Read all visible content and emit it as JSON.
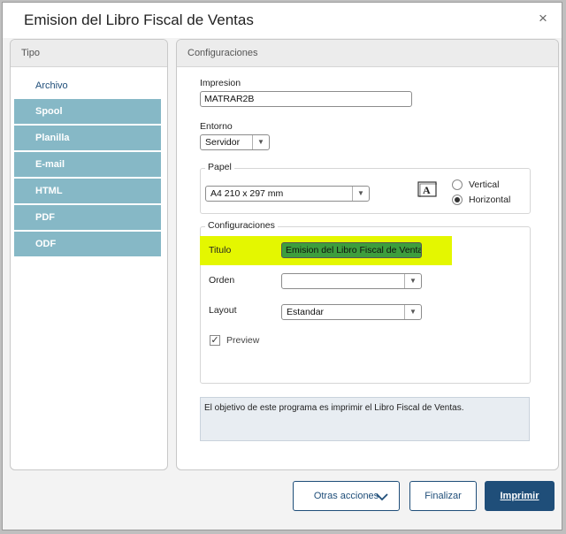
{
  "window": {
    "title": "Emision del Libro Fiscal de Ventas",
    "close_glyph": "×"
  },
  "tipo": {
    "header": "Tipo",
    "items": [
      {
        "label": "Archivo",
        "active": true
      },
      {
        "label": "Spool",
        "active": false
      },
      {
        "label": "Planilla",
        "active": false
      },
      {
        "label": "E-mail",
        "active": false
      },
      {
        "label": "HTML",
        "active": false
      },
      {
        "label": "PDF",
        "active": false
      },
      {
        "label": "ODF",
        "active": false
      }
    ]
  },
  "config": {
    "header": "Configuraciones",
    "impresion": {
      "label": "Impresion",
      "value": "MATRAR2B"
    },
    "entorno": {
      "label": "Entorno",
      "value": "Servidor"
    },
    "papel": {
      "legend": "Papel",
      "size": "A4 210 x 297 mm",
      "orientation_vertical": "Vertical",
      "orientation_horizontal": "Horizontal",
      "selected": "Horizontal"
    },
    "configuraciones": {
      "legend": "Configuraciones",
      "titulo_label": "Titulo",
      "titulo_value": "Emision del Libro Fiscal de Ventas",
      "orden_label": "Orden",
      "orden_value": "",
      "layout_label": "Layout",
      "layout_value": "Estandar",
      "preview_label": "Preview",
      "preview_checked": true
    },
    "description": "El objetivo de este programa es imprimir el Libro Fiscal de Ventas."
  },
  "footer": {
    "otras_acciones": "Otras acciones",
    "finalizar": "Finalizar",
    "imprimir": "Imprimir"
  },
  "colors": {
    "accent": "#1f4e79",
    "tab_inactive": "#86b8c6",
    "highlight": "#e4f700"
  }
}
